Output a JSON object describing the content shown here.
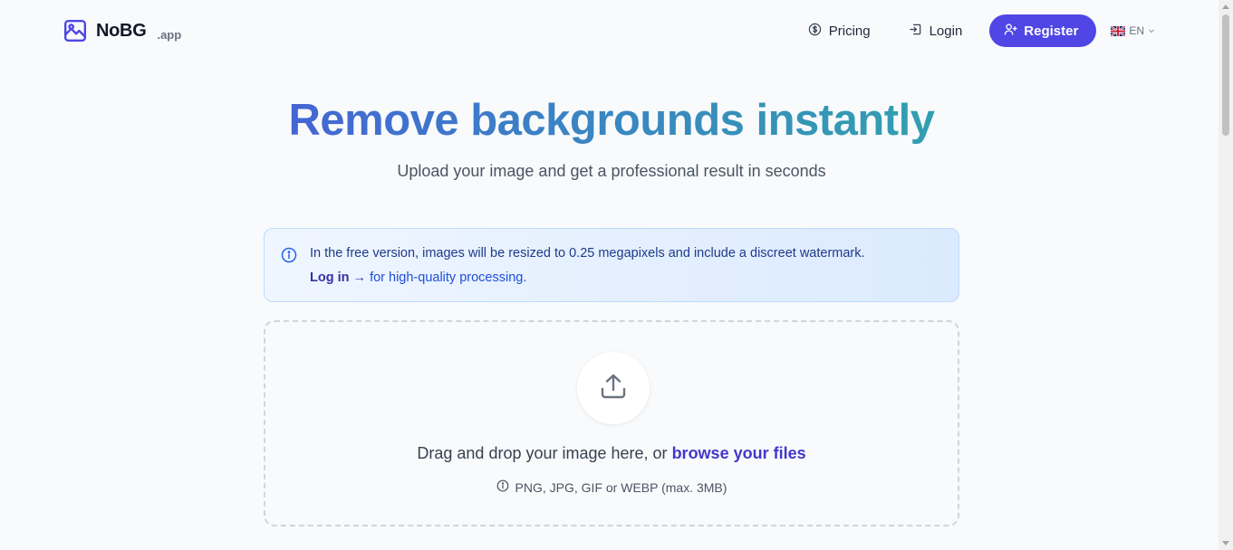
{
  "navbar": {
    "brand_name": "NoBG",
    "brand_suffix": ".app",
    "brand_icon": "image-icon",
    "pricing_label": "Pricing",
    "login_label": "Login",
    "register_label": "Register",
    "language_label": "EN"
  },
  "hero": {
    "title": "Remove backgrounds instantly",
    "subtitle": "Upload your image and get a professional result in seconds"
  },
  "notice": {
    "line1": "In the free version, images will be resized to 0.25 megapixels and include a discreet watermark.",
    "login_link": "Log in",
    "arrow": "→",
    "line2_rest": "for high-quality processing."
  },
  "dropzone": {
    "text_prefix": "Drag and drop your image here, or",
    "browse_link": "browse your files",
    "formats": "PNG, JPG, GIF or WEBP (max. 3MB)"
  },
  "colors": {
    "accent": "#4f46e5",
    "gradient_end": "#2bb5a0",
    "notice_bg": "#eff6ff"
  }
}
